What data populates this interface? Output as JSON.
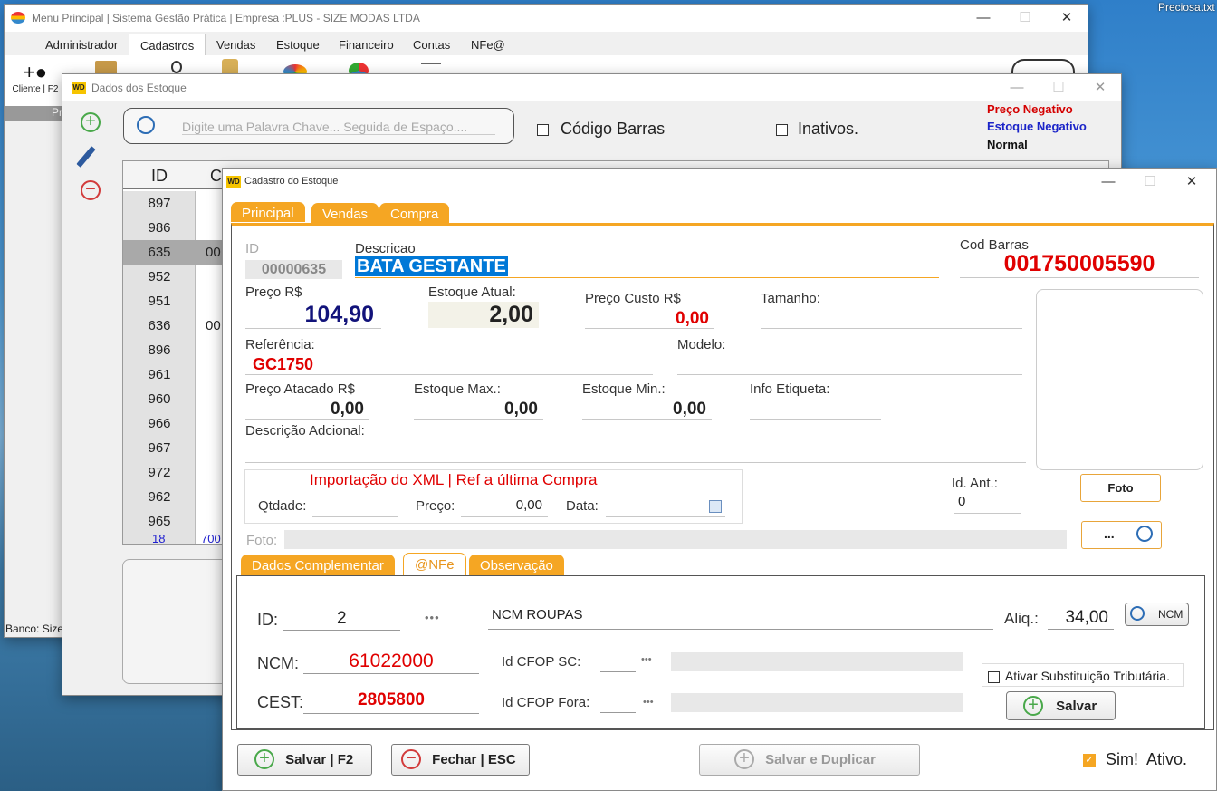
{
  "desktop": {
    "file_label": "Preciosa.txt"
  },
  "main_window": {
    "title": "Menu Principal | Sistema Gestão Prática | Empresa :PLUS - SIZE MODAS LTDA",
    "menu": [
      "Administrador",
      "Cadastros",
      "Vendas",
      "Estoque",
      "Financeiro",
      "Contas",
      "NFe@"
    ],
    "toolbar_first_label": "Cliente | F2",
    "side_label": "Pr",
    "status": "Banco: Size"
  },
  "stock_window": {
    "title": "Dados dos Estoque",
    "search_placeholder": "Digite uma Palavra Chave... Seguida de Espaço....",
    "barcode_check": "Código Barras",
    "inactive_check": "Inativos.",
    "legend": [
      {
        "label": "Preço Negativo",
        "color": "#d40000"
      },
      {
        "label": "Estoque Negativo",
        "color": "#1a23c8"
      },
      {
        "label": "Normal",
        "color": "#111111"
      }
    ],
    "grid": {
      "headers": [
        "ID",
        "Cód"
      ],
      "rows": [
        {
          "id": "897",
          "code": ""
        },
        {
          "id": "986",
          "code": ""
        },
        {
          "id": "635",
          "code": "00"
        },
        {
          "id": "952",
          "code": ""
        },
        {
          "id": "951",
          "code": ""
        },
        {
          "id": "636",
          "code": "00"
        },
        {
          "id": "896",
          "code": ""
        },
        {
          "id": "961",
          "code": ""
        },
        {
          "id": "960",
          "code": ""
        },
        {
          "id": "966",
          "code": ""
        },
        {
          "id": "967",
          "code": ""
        },
        {
          "id": "972",
          "code": ""
        },
        {
          "id": "962",
          "code": ""
        },
        {
          "id": "965",
          "code": ""
        }
      ],
      "partial_row": {
        "id": "18",
        "code": "700"
      }
    }
  },
  "form": {
    "title": "Cadastro do Estoque",
    "tabs": [
      "Principal",
      "Vendas",
      "Compra"
    ],
    "id_label": "ID",
    "id_value": "00000635",
    "descricao_label": "Descricao",
    "descricao_value": "BATA GESTANTE",
    "barcode_label": "Cod Barras",
    "barcode_value": "001750005590",
    "preco_label": "Preço R$",
    "preco_value": "104,90",
    "estoque_atual_label": "Estoque Atual:",
    "estoque_atual_value": "2,00",
    "preco_custo_label": "Preço Custo R$",
    "preco_custo_value": "0,00",
    "tamanho_label": "Tamanho:",
    "referencia_label": "Referência:",
    "referencia_value": "GC1750",
    "modelo_label": "Modelo:",
    "atacado_label": "Preço Atacado R$",
    "atacado_value": "0,00",
    "est_max_label": "Estoque Max.:",
    "est_max_value": "0,00",
    "est_min_label": "Estoque Min.:",
    "est_min_value": "0,00",
    "info_etiqueta_label": "Info Etiqueta:",
    "desc_adicional_label": "Descrição Adcional:",
    "xml_title": "Importação do XML | Ref a última Compra",
    "qtdade_label": "Qtdade:",
    "xml_preco_label": "Preço:",
    "xml_preco_value": "0,00",
    "data_label": "Data:",
    "id_ant_label": "Id. Ant.:",
    "id_ant_value": "0",
    "foto_button": "Foto",
    "foto_label": "Foto:",
    "browse_button": "...",
    "subtabs": [
      "Dados Complementar",
      "@NFe",
      "Observação"
    ],
    "nfe": {
      "id_label": "ID:",
      "id_value": "2",
      "dots": "•••",
      "ncm_desc": "NCM ROUPAS",
      "aliq_label": "Aliq.:",
      "aliq_value": "34,00",
      "ncm_button": "NCM",
      "ncm_label": "NCM:",
      "ncm_value": "61022000",
      "cfop_sc_label": "Id CFOP SC:",
      "cfop_dots": "•••",
      "cest_label": "CEST:",
      "cest_value": "2805800",
      "cfop_fora_label": "Id CFOP Fora:",
      "st_check": "Ativar Substituição Tributária.",
      "salvar": "Salvar"
    },
    "buttons": {
      "save": "Salvar | F2",
      "close": "Fechar | ESC",
      "save_dup": "Salvar e Duplicar"
    },
    "ativo_label": "Sim!  Ativo."
  },
  "colors": {
    "accent": "#f5a623",
    "price_blue": "#12137a",
    "red": "#e00000",
    "highlight": "#0078d7"
  }
}
